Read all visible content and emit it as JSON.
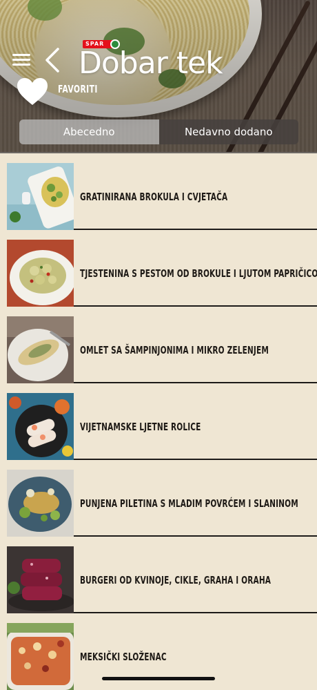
{
  "header": {
    "brand_badge": "SPAR",
    "title": "Dobar tek",
    "favorites_label": "FAVORITI",
    "menu_icon": "hamburger-icon",
    "back_icon": "chevron-left-icon",
    "favorites_icon": "heart-icon"
  },
  "segments": [
    {
      "label": "Abecedno",
      "selected": false
    },
    {
      "label": "Nedavno dodano",
      "selected": true
    }
  ],
  "recipes": [
    {
      "title": "Gratinirana brokula i cvjetača"
    },
    {
      "title": "Tjestenina s pestom od brokule i ljutom papričicom"
    },
    {
      "title": "Omlet sa šampinjonima i mikro zelenjem"
    },
    {
      "title": "Vijetnamske ljetne rolice"
    },
    {
      "title": "Punjena piletina s mladim povrćem i slaninom"
    },
    {
      "title": "Burgeri od kvinoje, cikle, graha i oraha"
    },
    {
      "title": "Meksički složenac"
    }
  ],
  "colors": {
    "background": "#efe6d3",
    "spar_red": "#e4101a",
    "spar_green": "#2d8c3c",
    "text": "#1e1a16"
  }
}
